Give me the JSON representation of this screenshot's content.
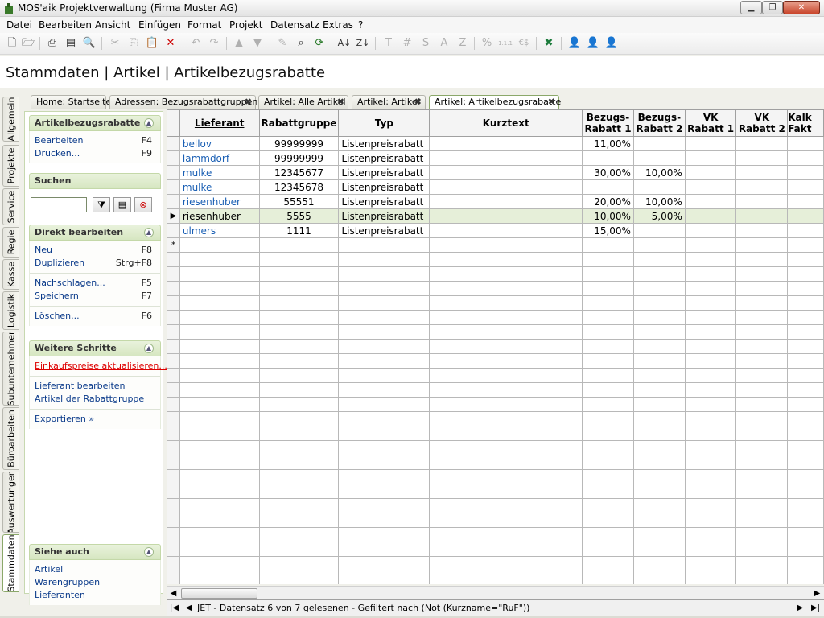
{
  "window": {
    "title": "MOS'aik Projektverwaltung (Firma Muster AG)",
    "min": "▁",
    "max": "❐",
    "close": "✕"
  },
  "menu": [
    "Datei",
    "Bearbeiten",
    "Ansicht",
    "Einfügen",
    "Format",
    "Projekt",
    "Datensatz",
    "Extras",
    "?"
  ],
  "toolbar": {
    "icons": [
      "new-icon",
      "open-icon",
      "print-icon",
      "print-preview-icon",
      "page-preview-icon",
      "cut-icon",
      "copy-icon",
      "paste-icon",
      "delete-icon",
      "undo-icon",
      "redo-icon",
      "move-up-icon",
      "move-down-icon",
      "edit-icon",
      "find-icon",
      "refresh-icon",
      "sort-asc-icon",
      "sort-desc-icon",
      "t-icon",
      "hash-icon",
      "s-icon",
      "a-icon",
      "z-icon",
      "percent-icon",
      "number-format-icon",
      "currency-icon",
      "excel-icon",
      "user-blue-icon",
      "user-yellow-icon",
      "user-red-icon"
    ],
    "labels": {
      "t": "T",
      "hash": "#",
      "s": "S",
      "a": "A",
      "z": "Z",
      "percent": "%",
      "number": "1.1.1",
      "currency": "€$"
    }
  },
  "page_title": "Stammdaten | Artikel | Artikelbezugsrabatte",
  "vertical_tabs": [
    "Allgemein",
    "Projekte",
    "Service",
    "Regie",
    "Kasse",
    "Logistik",
    "Subunternehmer",
    "Büroarbeiten",
    "Auswertungen",
    "Stammdaten"
  ],
  "tabs": [
    {
      "label": "Home: Startseite"
    },
    {
      "label": "Adressen: Bezugsrabattgruppen"
    },
    {
      "label": "Artikel: Alle Artikel"
    },
    {
      "label": "Artikel: Artikel"
    },
    {
      "label": "Artikel: Artikelbezugsrabatte"
    }
  ],
  "sidebar": {
    "g1": {
      "title": "Artikelbezugsrabatte",
      "items": [
        {
          "label": "Bearbeiten",
          "key": "F4"
        },
        {
          "label": "Drucken...",
          "key": "F9"
        }
      ]
    },
    "g2": {
      "title": "Suchen"
    },
    "g3": {
      "title": "Direkt bearbeiten",
      "items": [
        {
          "label": "Neu",
          "key": "F8"
        },
        {
          "label": "Duplizieren",
          "key": "Strg+F8"
        },
        {
          "label": "Nachschlagen...",
          "key": "F5"
        },
        {
          "label": "Speichern",
          "key": "F7"
        },
        {
          "label": "Löschen...",
          "key": "F6"
        }
      ]
    },
    "g4": {
      "title": "Weitere Schritte",
      "items": [
        {
          "label": "Einkaufspreise aktualisieren..."
        },
        {
          "label": "Lieferant bearbeiten"
        },
        {
          "label": "Artikel der Rabattgruppe"
        },
        {
          "label": "Exportieren »"
        }
      ]
    },
    "g5": {
      "title": "Siehe auch",
      "items": [
        {
          "label": "Artikel"
        },
        {
          "label": "Warengruppen"
        },
        {
          "label": "Lieferanten"
        }
      ]
    }
  },
  "grid": {
    "columns": [
      "Lieferant",
      "Rabattgruppe",
      "Typ",
      "Kurztext",
      "Bezugs-\nRabatt 1",
      "Bezugs-\nRabatt 2",
      "VK\nRabatt 1",
      "VK\nRabatt 2",
      "Kalk\nFakt"
    ],
    "rows": [
      [
        "bellov",
        "99999999",
        "Listenpreisrabatt",
        "",
        "11,00%",
        "",
        "",
        "",
        ""
      ],
      [
        "lammdorf",
        "99999999",
        "Listenpreisrabatt",
        "",
        "",
        "",
        "",
        "",
        ""
      ],
      [
        "mulke",
        "12345677",
        "Listenpreisrabatt",
        "",
        "30,00%",
        "10,00%",
        "",
        "",
        ""
      ],
      [
        "mulke",
        "12345678",
        "Listenpreisrabatt",
        "",
        "",
        "",
        "",
        "",
        ""
      ],
      [
        "riesenhuber",
        "55551",
        "Listenpreisrabatt",
        "",
        "20,00%",
        "10,00%",
        "",
        "",
        ""
      ],
      [
        "riesenhuber",
        "5555",
        "Listenpreisrabatt",
        "",
        "10,00%",
        "5,00%",
        "",
        "",
        ""
      ],
      [
        "ulmers",
        "1111",
        "Listenpreisrabatt",
        "",
        "15,00%",
        "",
        "",
        "",
        ""
      ]
    ],
    "current_row": 5,
    "current_marker": "▶",
    "new_row_marker": "*"
  },
  "navigator": {
    "status": "JET - Datensatz 6 von 7 gelesenen - Gefiltert nach (Not (Kurzname=\"RuF\"))",
    "first": "|◀",
    "prev": "◀",
    "next": "▶",
    "last": "▶|"
  }
}
